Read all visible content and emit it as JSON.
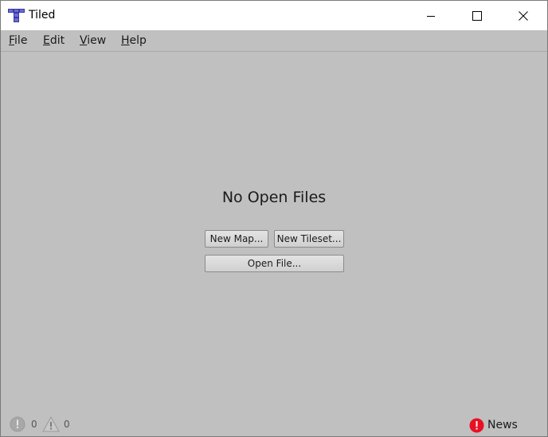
{
  "window": {
    "title": "Tiled",
    "icon": "tiled-app-icon"
  },
  "titlebar": {
    "minimize_icon": "minimize-icon",
    "maximize_icon": "maximize-icon",
    "close_icon": "close-icon"
  },
  "menu": {
    "items": [
      {
        "mnemonic": "F",
        "rest": "ile"
      },
      {
        "mnemonic": "E",
        "rest": "dit"
      },
      {
        "mnemonic": "V",
        "rest": "iew"
      },
      {
        "mnemonic": "H",
        "rest": "elp"
      }
    ]
  },
  "main": {
    "heading": "No Open Files",
    "new_map_label": "New Map...",
    "new_tileset_label": "New Tileset...",
    "open_file_label": "Open File..."
  },
  "status": {
    "error_count": "0",
    "warning_count": "0",
    "error_icon": "error-icon",
    "warning_icon": "warning-icon",
    "news_label": "News",
    "news_icon": "alert-icon"
  },
  "colors": {
    "background": "#c0c0c0",
    "titlebar": "#ffffff",
    "news_alert": "#e81123",
    "app_icon_blue": "#3a3aa0"
  }
}
